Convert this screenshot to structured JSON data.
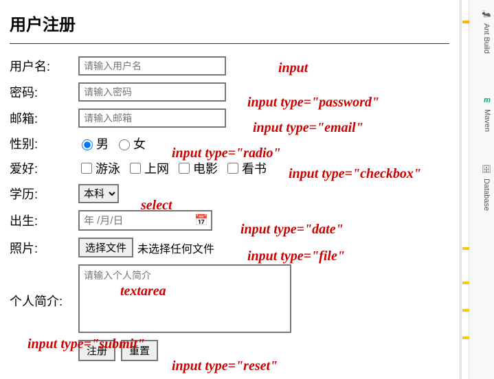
{
  "title": "用户注册",
  "form": {
    "username": {
      "label": "用户名:",
      "placeholder": "请输入用户名"
    },
    "password": {
      "label": "密码:",
      "placeholder": "请输入密码"
    },
    "email": {
      "label": "邮箱:",
      "placeholder": "请输入邮箱"
    },
    "gender": {
      "label": "性别:",
      "options": {
        "male": "男",
        "female": "女"
      }
    },
    "hobby": {
      "label": "爱好:",
      "options": {
        "swim": "游泳",
        "surf": "上网",
        "movie": "电影",
        "read": "看书"
      }
    },
    "education": {
      "label": "学历:",
      "selected": "本科"
    },
    "birth": {
      "label": "出生:",
      "placeholder": "年 /月/日"
    },
    "photo": {
      "label": "照片:",
      "button": "选择文件",
      "status": "未选择任何文件"
    },
    "bio": {
      "label": "个人简介:",
      "placeholder": "请输入个人简介"
    },
    "submit": "注册",
    "reset": "重置"
  },
  "annotations": {
    "input": "input",
    "password": "input type=\"password\"",
    "email": "input type=\"email\"",
    "radio": "input type=\"radio\"",
    "checkbox": "input type=\"checkbox\"",
    "select": "select",
    "date": "input type=\"date\"",
    "file": "input type=\"file\"",
    "textarea": "textarea",
    "submit": "input type=\"submit\"",
    "reset": "input type=\"reset\""
  },
  "ide": {
    "tabs": {
      "ant": "Ant Build",
      "maven": "Maven",
      "database": "Database"
    }
  }
}
